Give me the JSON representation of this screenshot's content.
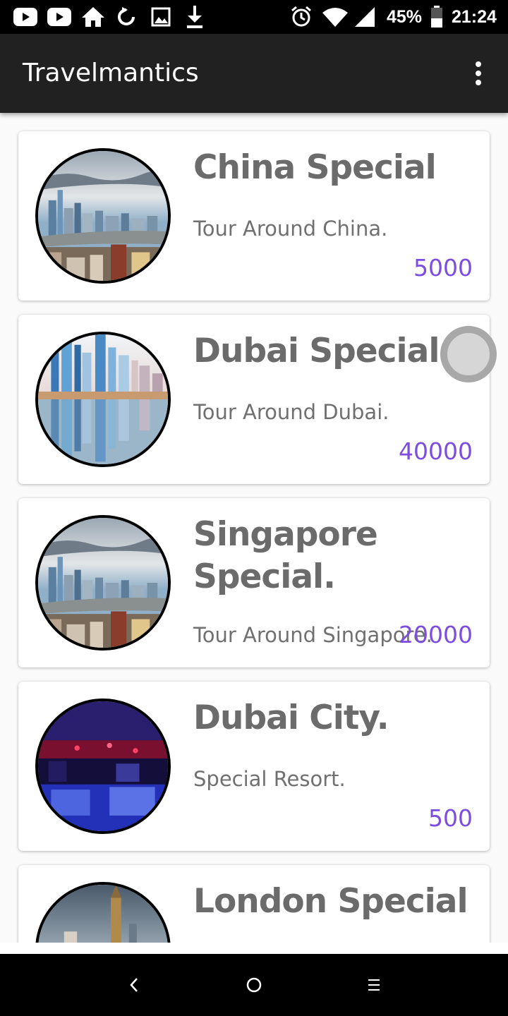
{
  "status_bar": {
    "battery": "45%",
    "time": "21:24",
    "icons": [
      "youtube-icon",
      "youtube-icon",
      "home-icon",
      "sync-icon",
      "image-icon",
      "download-icon",
      "alarm-icon",
      "wifi-icon",
      "signal-icon",
      "battery-icon"
    ]
  },
  "app_bar": {
    "title": "Travelmantics",
    "menu_icon": "more-vert-icon"
  },
  "deals": [
    {
      "title": "China Special",
      "description": "Tour Around China.",
      "price": "5000",
      "image": "city-skyline-day"
    },
    {
      "title": "Dubai Special",
      "description": "Tour Around Dubai.",
      "price": "40000",
      "image": "city-skyline-reflection"
    },
    {
      "title": "Singapore Special.",
      "description": "Tour Around Singapore.",
      "price": "20000",
      "image": "city-skyline-day"
    },
    {
      "title": "Dubai City.",
      "description": "Special Resort.",
      "price": "500",
      "image": "night-club-interior"
    },
    {
      "title": "London Special",
      "description": "",
      "price": "",
      "image": "london-skyline"
    }
  ],
  "nav_bar": {
    "back_icon": "back-icon",
    "home_icon": "home-circle-icon",
    "recents_icon": "recents-icon"
  },
  "colors": {
    "app_bar": "#212121",
    "price": "#7c4dde",
    "title": "#6b6b6b"
  }
}
